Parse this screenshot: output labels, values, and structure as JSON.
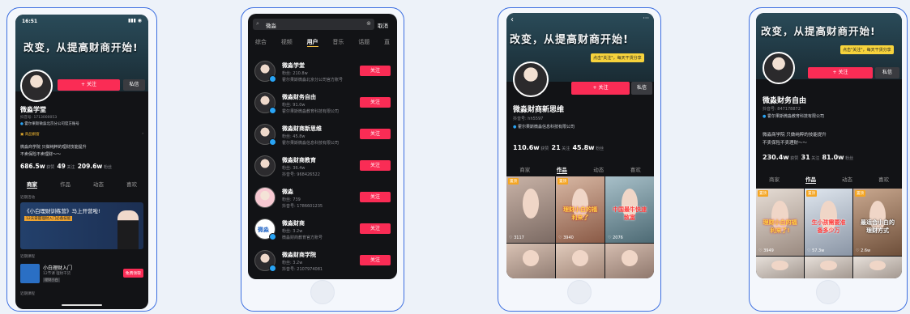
{
  "screen1": {
    "status_time": "16:51",
    "banner": "改变，从提高财商开始!",
    "follow_btn": "+ 关注",
    "msg_btn": "私信",
    "name": "微淼学堂",
    "id_line": "抖音号: 1713000053",
    "verify": "霍尔果斯微淼北京分公司官方账号",
    "notice_title": "商品橱窗",
    "bio1": "微淼商学院 只做纯粹的理财技能提升",
    "bio2": "不卖保险不卖理财～～",
    "stats": [
      {
        "v": "686.5w",
        "l": "获赞"
      },
      {
        "v": "49",
        "l": "关注"
      },
      {
        "v": "209.6w",
        "l": "粉丝"
      }
    ],
    "tabs": [
      "商家",
      "作品",
      "动态",
      "喜欢"
    ],
    "active_tab": "商家",
    "section_live": "近期活动",
    "promo_title": "《小白理财训练营》马上开营啦!",
    "promo_sub": "12天掌握理财入门必备技能",
    "section_course": "近期课程",
    "course_title": "小白理财入门",
    "course_sub": "12节课 理财干货",
    "course_tag": "理财小白",
    "course_btn": "免费领取",
    "section_more": "近期课程"
  },
  "screen2": {
    "search_value": "微淼",
    "cancel": "取消",
    "tabs": [
      "综合",
      "视频",
      "用户",
      "音乐",
      "话题",
      "直"
    ],
    "active_tab": "用户",
    "follow_label": "关注",
    "users": [
      {
        "name": "微淼学堂",
        "line1": "粉丝: 210.8w",
        "line2": "霍尔果斯微淼北京分公司官方账号"
      },
      {
        "name": "微淼财务自由",
        "line1": "粉丝: 91.0w",
        "line2": "霍尔果斯微淼教育科技有限公司"
      },
      {
        "name": "微淼财商新思维",
        "line1": "粉丝: 45.8w",
        "line2": "霍尔果斯微淼信息科技有限公司"
      },
      {
        "name": "微淼财商教育",
        "line1": "粉丝: 36.4w",
        "line2": "抖音号: 968426522"
      },
      {
        "name": "微淼",
        "line1": "粉丝: 739",
        "line2": "抖音号: 1786601235"
      },
      {
        "name": "微淼财商",
        "line1": "粉丝: 3.2w",
        "line2": "微淼财商教育官方账号"
      },
      {
        "name": "微淼财商学院",
        "line1": "粉丝: 3.2w",
        "line2": "抖音号: 2107974081"
      }
    ]
  },
  "screen3": {
    "banner": "改变，从提高财商开始!",
    "sticker": "点击\"关注\"，每天干货分享",
    "follow_btn": "+ 关注",
    "msg_btn": "私信",
    "name": "微淼财商新思维",
    "id_line": "抖音号: hh5597",
    "verify": "霍尔果斯微淼信息科技有限公司",
    "stats": [
      {
        "v": "110.6w",
        "l": "获赞"
      },
      {
        "v": "21",
        "l": "关注"
      },
      {
        "v": "45.8w",
        "l": "粉丝"
      }
    ],
    "tabs": [
      "商家",
      "作品",
      "动态",
      "喜欢"
    ],
    "active_tab": "作品",
    "videos": [
      {
        "badge": "置顶",
        "count": "3117",
        "caption": ""
      },
      {
        "badge": "置顶",
        "count": "3940",
        "caption": "理财小白的福利来了"
      },
      {
        "badge": "",
        "count": "2076",
        "caption": "中国最牛快速致富"
      }
    ]
  },
  "screen4": {
    "banner": "改变，从提高财商开始!",
    "sticker": "点击\"关注\"，每天干货分享",
    "follow_btn": "+ 关注",
    "msg_btn": "私信",
    "name": "微淼财务自由",
    "id_line": "抖音号: 847178872",
    "verify": "霍尔果斯微淼教育科技有限公司",
    "bio1": "微淼商学院 只做纯粹的技能提升",
    "bio2": "不卖保险不卖理财～～",
    "stats": [
      {
        "v": "230.4w",
        "l": "获赞"
      },
      {
        "v": "31",
        "l": "关注"
      },
      {
        "v": "81.0w",
        "l": "粉丝"
      }
    ],
    "tabs": [
      "商家",
      "作品",
      "动态",
      "喜欢"
    ],
    "active_tab": "作品",
    "videos": [
      {
        "badge": "置顶",
        "count": "3949",
        "caption": "理财小白的福利来了!"
      },
      {
        "badge": "置顶",
        "count": "57.3w",
        "caption": "生小孩需要准备多少万"
      },
      {
        "badge": "置顶",
        "count": "2.6w",
        "caption": "最适合小白的理财方式"
      }
    ]
  }
}
